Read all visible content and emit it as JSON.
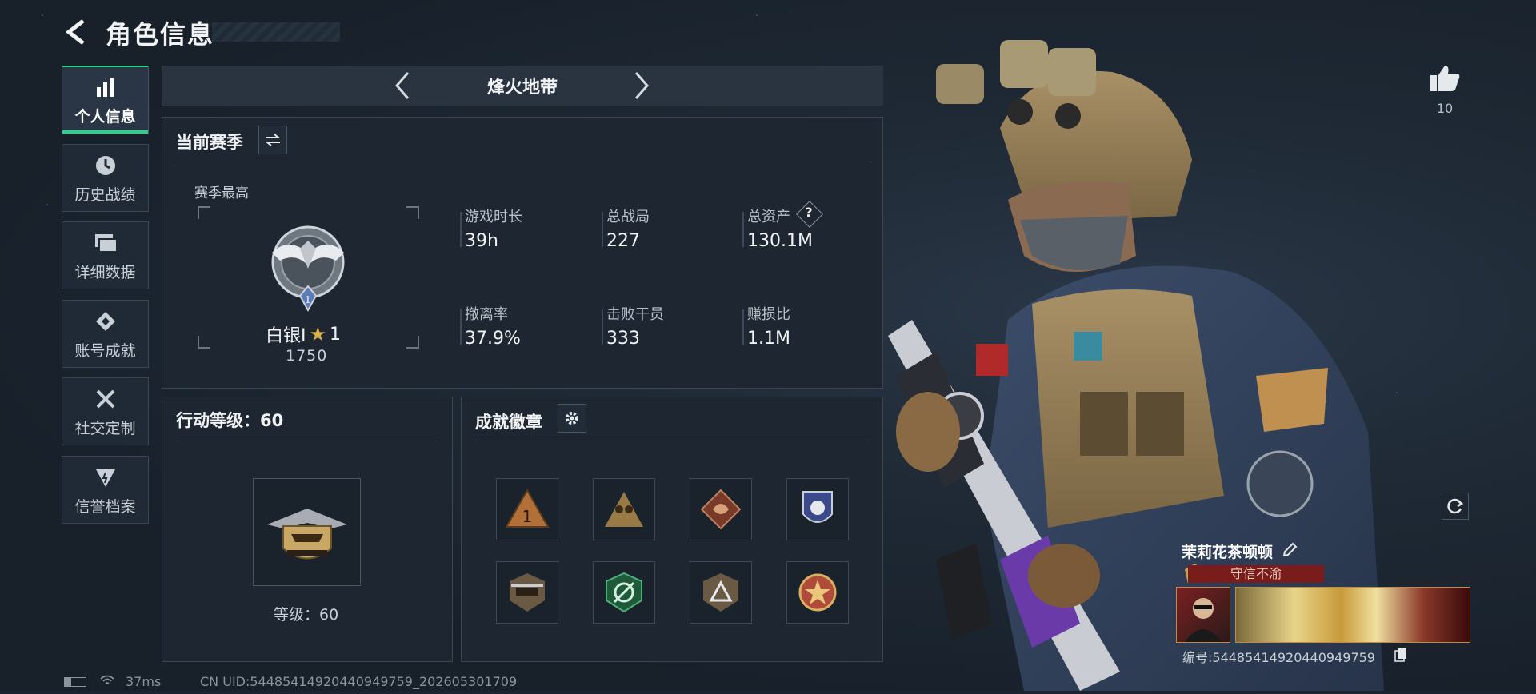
{
  "header": {
    "title": "角色信息"
  },
  "sidebar": {
    "items": [
      {
        "label": "个人信息",
        "icon": "bar-chart-icon",
        "active": true
      },
      {
        "label": "历史战绩",
        "icon": "clock-icon"
      },
      {
        "label": "详细数据",
        "icon": "folder-icon"
      },
      {
        "label": "账号成就",
        "icon": "diamond-icon"
      },
      {
        "label": "社交定制",
        "icon": "tools-icon"
      },
      {
        "label": "信誉档案",
        "icon": "shield-icon"
      }
    ]
  },
  "mode": {
    "label": "烽火地带"
  },
  "season": {
    "title": "当前赛季",
    "subtitle": "赛季最高",
    "rank_name": "白银I",
    "rank_stars": "1",
    "rank_points": "1750",
    "stats": [
      {
        "label": "游戏时长",
        "value": "39h"
      },
      {
        "label": "总战局",
        "value": "227"
      },
      {
        "label": "总资产",
        "value": "130.1M",
        "help": "?"
      },
      {
        "label": "撤离率",
        "value": "37.9%"
      },
      {
        "label": "击败干员",
        "value": "333"
      },
      {
        "label": "赚损比",
        "value": "1.1M"
      }
    ]
  },
  "operation": {
    "title": "行动等级：60",
    "level_text": "等级：60"
  },
  "achievements": {
    "title": "成就徽章"
  },
  "player": {
    "likes": "10",
    "name": "茉莉花茶顿顿",
    "tag": "守信不渝",
    "id_text": "编号:5448541492044094975​9"
  },
  "status_bar": {
    "ping": "37ms",
    "uid": "CN UID:54485414920440949759_202605301709"
  },
  "colors": {
    "accent": "#2bd38a",
    "background": "#1b2430",
    "tag_red": "#7a1c1c"
  }
}
